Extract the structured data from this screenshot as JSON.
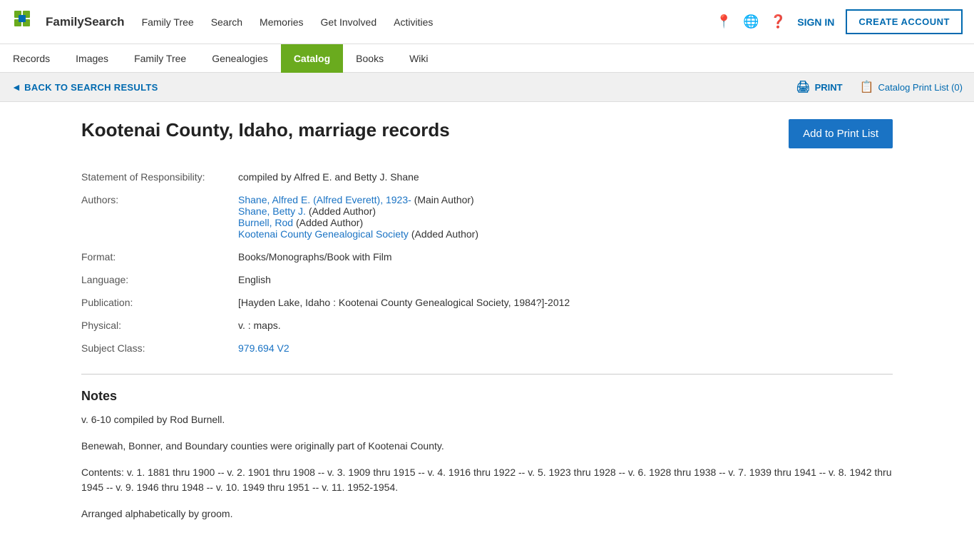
{
  "header": {
    "logo_text": "FamilySearch",
    "nav": [
      {
        "label": "Family Tree",
        "id": "nav-family-tree"
      },
      {
        "label": "Search",
        "id": "nav-search"
      },
      {
        "label": "Memories",
        "id": "nav-memories"
      },
      {
        "label": "Get Involved",
        "id": "nav-get-involved"
      },
      {
        "label": "Activities",
        "id": "nav-activities"
      }
    ],
    "sign_in": "SIGN IN",
    "create_account": "CREATE ACCOUNT"
  },
  "sub_nav": {
    "items": [
      {
        "label": "Records",
        "id": "subnav-records",
        "active": false
      },
      {
        "label": "Images",
        "id": "subnav-images",
        "active": false
      },
      {
        "label": "Family Tree",
        "id": "subnav-family-tree",
        "active": false
      },
      {
        "label": "Genealogies",
        "id": "subnav-genealogies",
        "active": false
      },
      {
        "label": "Catalog",
        "id": "subnav-catalog",
        "active": true
      },
      {
        "label": "Books",
        "id": "subnav-books",
        "active": false
      },
      {
        "label": "Wiki",
        "id": "subnav-wiki",
        "active": false
      }
    ]
  },
  "back_bar": {
    "back_label": "BACK TO SEARCH RESULTS",
    "print_label": "PRINT",
    "catalog_print_list_label": "Catalog Print List (0)"
  },
  "record": {
    "title": "Kootenai County, Idaho, marriage records",
    "add_to_print_label": "Add to Print List",
    "fields": [
      {
        "label": "Statement of Responsibility:",
        "value": "compiled by Alfred E. and Betty J. Shane",
        "is_link": false,
        "multi": false
      },
      {
        "label": "Authors:",
        "value": "",
        "is_link": false,
        "multi": true,
        "authors": [
          {
            "name": "Shane, Alfred E. (Alfred Everett), 1923-",
            "role": "(Main Author)",
            "is_link": true
          },
          {
            "name": "Shane, Betty J.",
            "role": "(Added Author)",
            "is_link": true
          },
          {
            "name": "Burnell, Rod",
            "role": "(Added Author)",
            "is_link": true
          },
          {
            "name": "Kootenai County Genealogical Society",
            "role": "(Added Author)",
            "is_link": true
          }
        ]
      },
      {
        "label": "Format:",
        "value": "Books/Monographs/Book with Film",
        "is_link": false,
        "multi": false
      },
      {
        "label": "Language:",
        "value": "English",
        "is_link": false,
        "multi": false
      },
      {
        "label": "Publication:",
        "value": "[Hayden Lake, Idaho : Kootenai County Genealogical Society, 1984?]-2012",
        "is_link": false,
        "multi": false
      },
      {
        "label": "Physical:",
        "value": "v. : maps.",
        "is_link": false,
        "multi": false
      },
      {
        "label": "Subject Class:",
        "value": "979.694 V2",
        "is_link": true,
        "multi": false
      }
    ]
  },
  "notes": {
    "heading": "Notes",
    "paragraphs": [
      "v. 6-10 compiled by Rod Burnell.",
      "Benewah, Bonner, and Boundary counties were originally part of Kootenai County.",
      "Contents: v. 1. 1881 thru 1900 -- v. 2. 1901 thru 1908 -- v. 3. 1909 thru 1915 -- v. 4. 1916 thru 1922 -- v. 5. 1923 thru 1928 -- v. 6. 1928 thru 1938 -- v. 7. 1939 thru 1941 -- v. 8. 1942 thru 1945 -- v. 9. 1946 thru 1948 -- v. 10. 1949 thru 1951 -- v. 11. 1952-1954.",
      "Arranged alphabetically by groom."
    ]
  }
}
